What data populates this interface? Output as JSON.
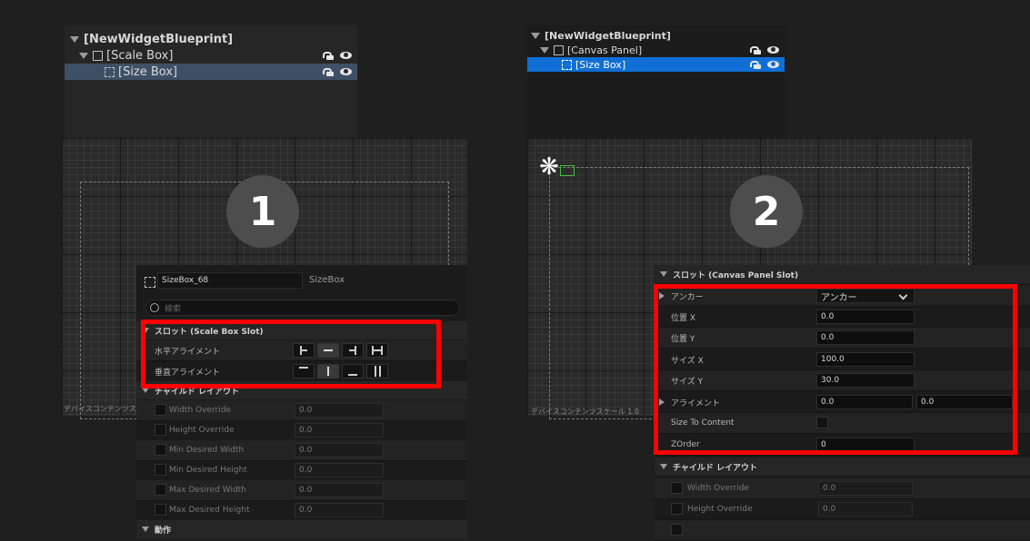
{
  "panel1": {
    "hierarchy": {
      "root": "[NewWidgetBlueprint]",
      "child": "[Scale Box]",
      "grandchild": "[Size Box]"
    },
    "badge": "1",
    "device_label": "デバイスコンテンツス",
    "details": {
      "name_value": "SizeBox_68",
      "type_label": "SizeBox",
      "search_placeholder": "検索",
      "slot_section": "スロット (Scale Box Slot)",
      "h_align_label": "水平アライメント",
      "v_align_label": "垂直アライメント",
      "child_layout_section": "チャイルド レイアウト",
      "rows": [
        {
          "label": "Width Override",
          "value": "0.0"
        },
        {
          "label": "Height Override",
          "value": "0.0"
        },
        {
          "label": "Min Desired Width",
          "value": "0.0"
        },
        {
          "label": "Min Desired Height",
          "value": "0.0"
        },
        {
          "label": "Max Desired Width",
          "value": "0.0"
        },
        {
          "label": "Max Desired Height",
          "value": "0.0"
        }
      ],
      "behavior_section": "動作"
    }
  },
  "panel2": {
    "hierarchy": {
      "root": "[NewWidgetBlueprint]",
      "child": "[Canvas Panel]",
      "grandchild": "[Size Box]"
    },
    "badge": "2",
    "device_label": "デバイスコンテンツスケール 1.0",
    "details": {
      "slot_section": "スロット (Canvas Panel Slot)",
      "anchor_label": "アンカー",
      "anchor_value": "アンカー",
      "pos_x_label": "位置 X",
      "pos_x_value": "0.0",
      "pos_y_label": "位置 Y",
      "pos_y_value": "0.0",
      "size_x_label": "サイズ X",
      "size_x_value": "100.0",
      "size_y_label": "サイズ Y",
      "size_y_value": "30.0",
      "alignment_label": "アライメント",
      "alignment_x": "0.0",
      "alignment_y": "0.0",
      "size_to_content_label": "Size To Content",
      "zorder_label": "ZOrder",
      "zorder_value": "0",
      "child_layout_section": "チャイルド レイアウト",
      "rows": [
        {
          "label": "Width Override",
          "value": "0.0"
        },
        {
          "label": "Height Override",
          "value": "0.0"
        }
      ]
    }
  },
  "colors": {
    "highlight": "#ff0000",
    "selection_blue": "#0f6fd6",
    "selection_gray": "#3e5066"
  }
}
